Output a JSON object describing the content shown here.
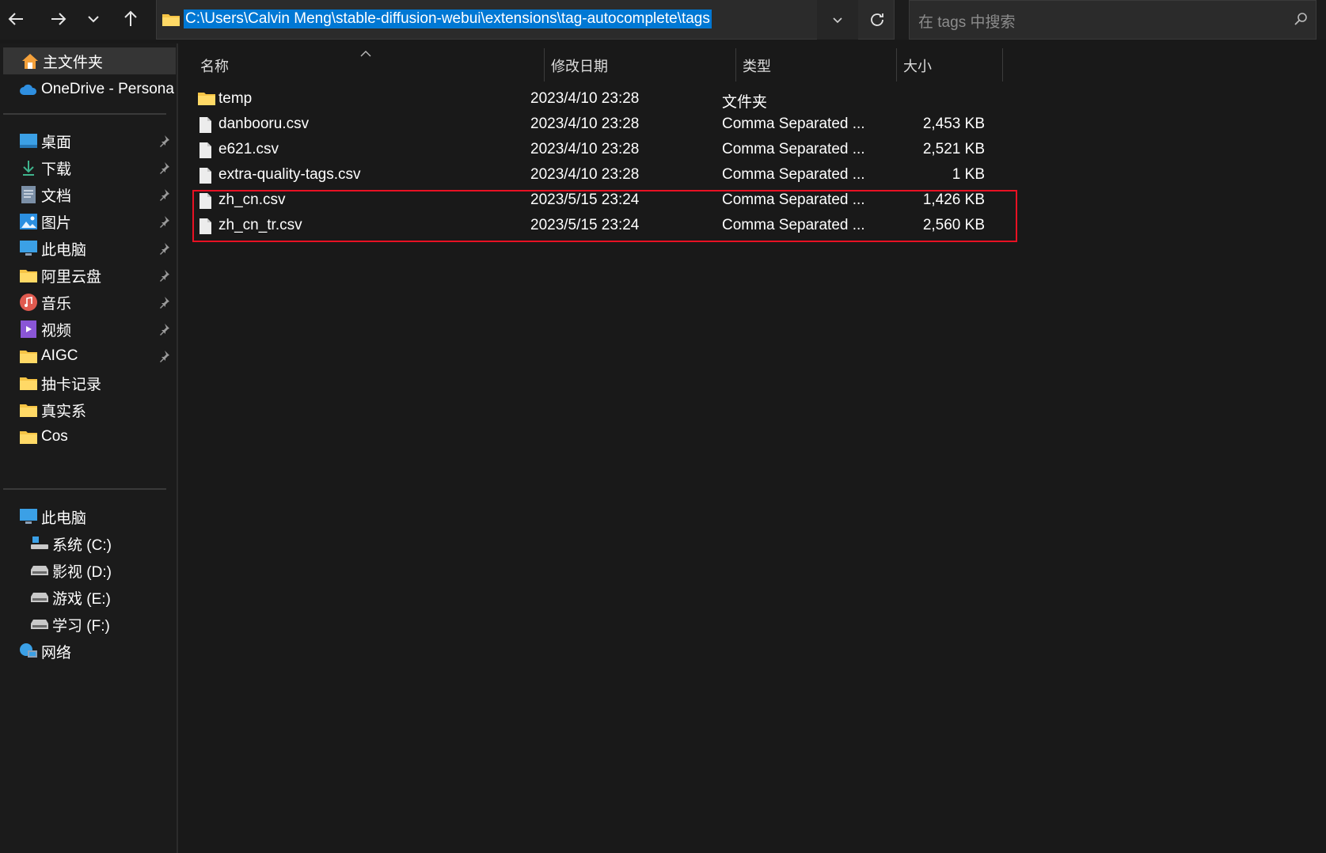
{
  "toolbar": {
    "address_path": "C:\\Users\\Calvin Meng\\stable-diffusion-webui\\extensions\\tag-autocomplete\\tags",
    "search_placeholder": "在 tags 中搜索"
  },
  "sidebar": {
    "home": "主文件夹",
    "onedrive": "OneDrive - Persona",
    "quick_access": [
      {
        "label": "桌面",
        "icon": "desktop-icon"
      },
      {
        "label": "下载",
        "icon": "download-icon"
      },
      {
        "label": "文档",
        "icon": "documents-icon"
      },
      {
        "label": "图片",
        "icon": "pictures-icon"
      },
      {
        "label": "此电脑",
        "icon": "computer-icon"
      },
      {
        "label": "阿里云盘",
        "icon": "folder-icon"
      },
      {
        "label": "音乐",
        "icon": "music-icon"
      },
      {
        "label": "视频",
        "icon": "videos-icon"
      },
      {
        "label": "AIGC",
        "icon": "folder-icon"
      },
      {
        "label": "抽卡记录",
        "icon": "folder-icon"
      },
      {
        "label": "真实系",
        "icon": "folder-icon"
      },
      {
        "label": "Cos",
        "icon": "folder-icon"
      }
    ],
    "this_pc": "此电脑",
    "drives": [
      {
        "label": "系统 (C:)",
        "icon": "system-drive-icon"
      },
      {
        "label": "影视 (D:)",
        "icon": "drive-icon"
      },
      {
        "label": "游戏 (E:)",
        "icon": "drive-icon"
      },
      {
        "label": "学习 (F:)",
        "icon": "drive-icon"
      }
    ],
    "network": "网络"
  },
  "columns": {
    "name": "名称",
    "modified": "修改日期",
    "type": "类型",
    "size": "大小"
  },
  "files": [
    {
      "name": "temp",
      "modified": "2023/4/10 23:28",
      "type": "文件夹",
      "size": "",
      "icon": "folder-icon"
    },
    {
      "name": "danbooru.csv",
      "modified": "2023/4/10 23:28",
      "type": "Comma Separated ...",
      "size": "2,453 KB",
      "icon": "file-icon"
    },
    {
      "name": "e621.csv",
      "modified": "2023/4/10 23:28",
      "type": "Comma Separated ...",
      "size": "2,521 KB",
      "icon": "file-icon"
    },
    {
      "name": "extra-quality-tags.csv",
      "modified": "2023/4/10 23:28",
      "type": "Comma Separated ...",
      "size": "1 KB",
      "icon": "file-icon"
    },
    {
      "name": "zh_cn.csv",
      "modified": "2023/5/15 23:24",
      "type": "Comma Separated ...",
      "size": "1,426 KB",
      "icon": "file-icon"
    },
    {
      "name": "zh_cn_tr.csv",
      "modified": "2023/5/15 23:24",
      "type": "Comma Separated ...",
      "size": "2,560 KB",
      "icon": "file-icon"
    }
  ],
  "colors": {
    "background": "#191919",
    "selection": "#0078d4",
    "highlight_box": "#e81123",
    "folder": "#f6c445"
  }
}
